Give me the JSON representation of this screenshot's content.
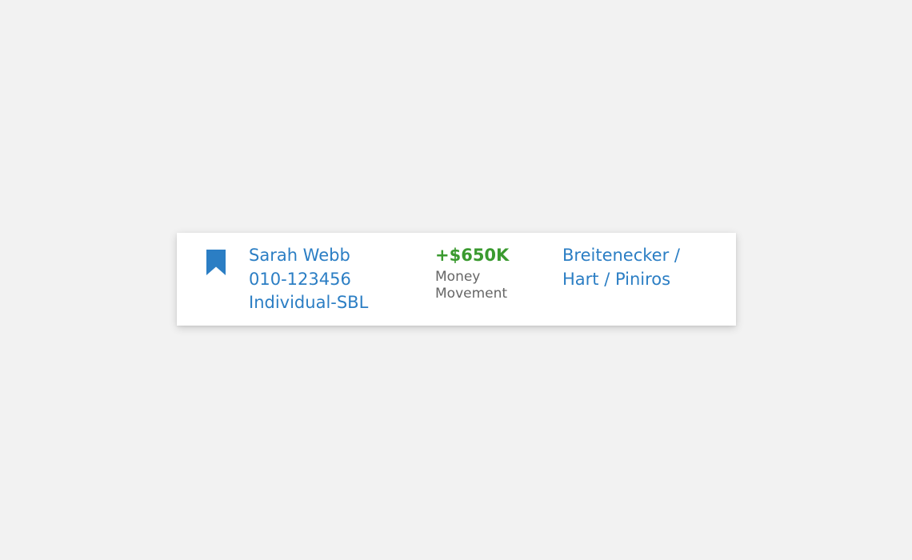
{
  "colors": {
    "page_background": "#f2f2f2",
    "card_background": "#ffffff",
    "accent_blue": "#2b7ec4",
    "positive_green": "#3a9a2f",
    "muted_text": "#666666"
  },
  "card": {
    "bookmark_icon": "bookmark-icon",
    "client": {
      "name": "Sarah Webb",
      "account_number": "010-123456",
      "account_type": "Individual-SBL"
    },
    "activity": {
      "amount": "+$650K",
      "type_line1": "Money",
      "type_line2": "Movement"
    },
    "advisors": {
      "line1": "Breitenecker /",
      "line2": "Hart / Piniros"
    }
  }
}
